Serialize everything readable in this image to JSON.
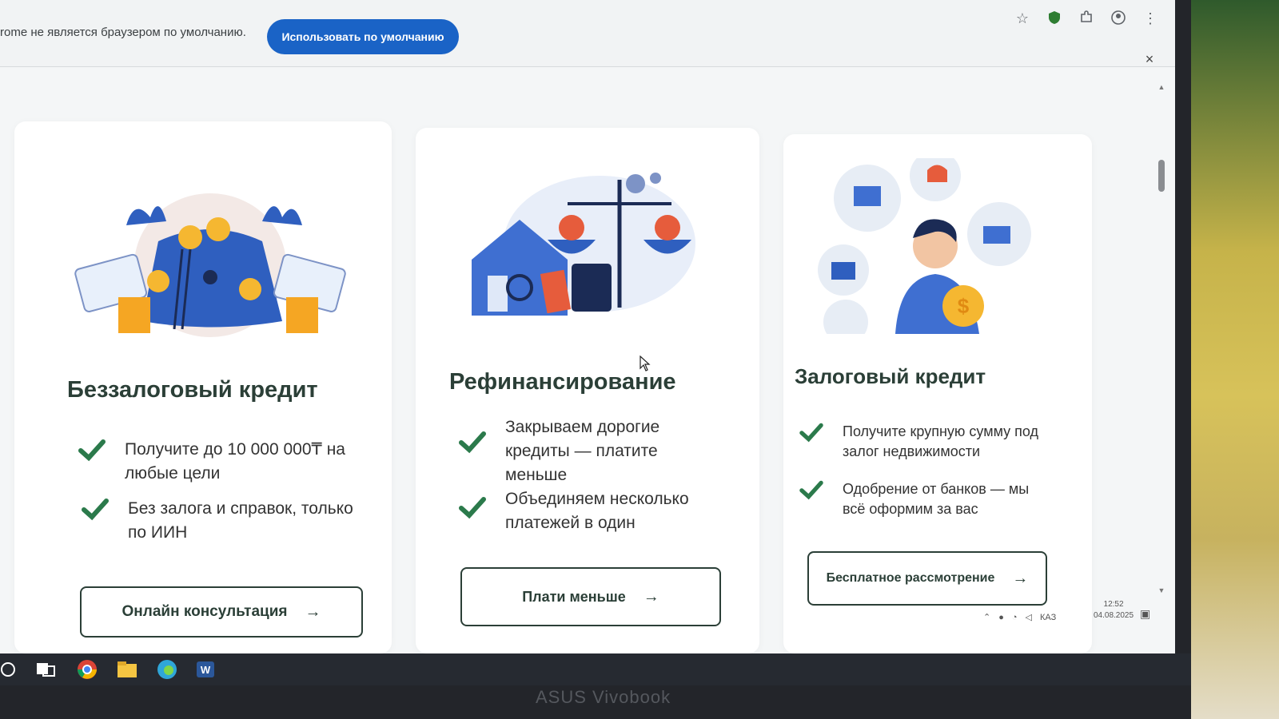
{
  "browser": {
    "infobar_message": "rome не является браузером по умолчанию.",
    "default_button_label": "Использовать по умолчанию",
    "close_label": "×"
  },
  "cards": [
    {
      "title": "Беззалоговый кредит",
      "features": [
        "Получите до 10 000 000₸ на любые цели",
        "Без залога и справок, только по ИИН"
      ],
      "button_label": "Онлайн консультация",
      "arrow": "→"
    },
    {
      "title": "Рефинансирование",
      "features": [
        "Закрываем дорогие кредиты — платите меньше",
        "Объединяем несколько платежей в один"
      ],
      "button_label": "Плати меньше",
      "arrow": "→"
    },
    {
      "title": "Залоговый кредит",
      "features": [
        "Получите крупную сумму под залог недвижимости",
        "Одобрение от банков — мы всё оформим за вас"
      ],
      "button_label": "Бесплатное рассмотрение",
      "arrow": "→"
    }
  ],
  "taskbar": {
    "time": "12:52",
    "date": "04.08.2025",
    "lang": "КАЗ"
  },
  "device": {
    "brand": "ASUS Vivobook"
  },
  "colors": {
    "accent_green": "#2b7a4b",
    "title_dark": "#2b3f37",
    "infobar_button": "#1a63c6",
    "illustration_blue": "#2f5fbf",
    "coin_orange": "#f5a623"
  }
}
